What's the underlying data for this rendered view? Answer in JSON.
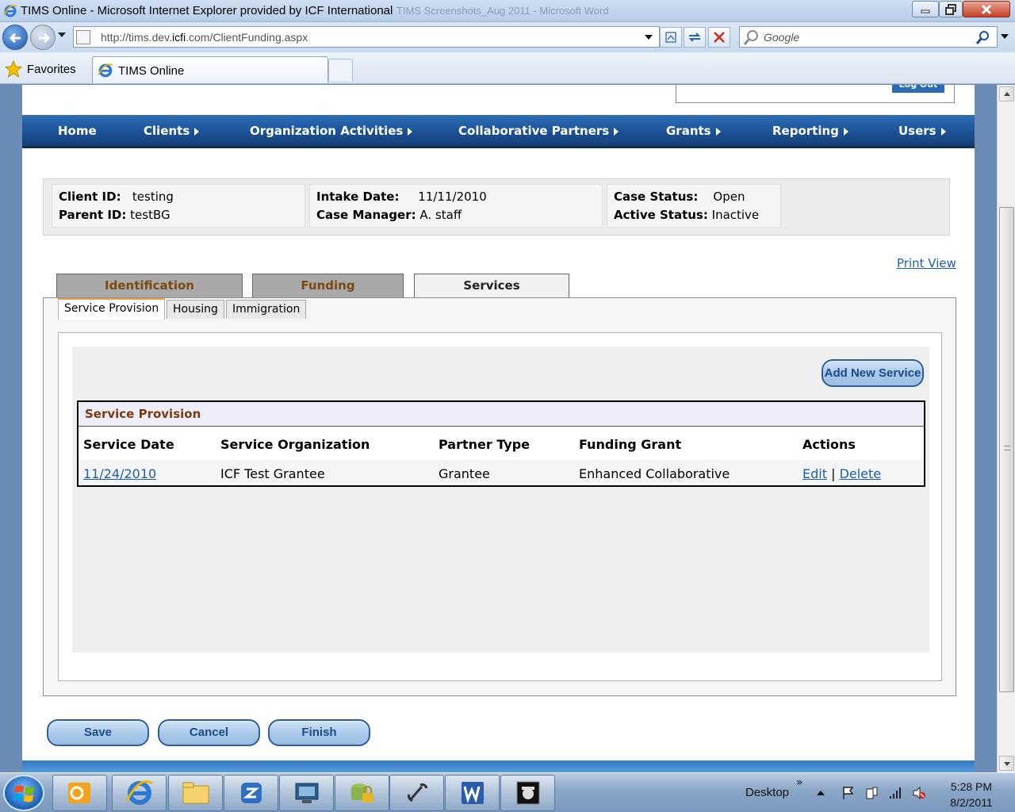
{
  "window": {
    "title": "TIMS Online - Microsoft Internet Explorer provided by ICF International",
    "ghost_title": "TIMS Screenshots_Aug 2011 - Microsoft Word"
  },
  "addressbar": {
    "url_prefix": "http://tims.dev.",
    "url_domain": "icfi",
    "url_suffix": ".com/ClientFunding.aspx",
    "search_placeholder": "Google"
  },
  "favbar": {
    "favorites_label": "Favorites",
    "tab_title": "TIMS Online"
  },
  "header": {
    "logout_label": "Log Out"
  },
  "nav": {
    "items": [
      {
        "label": "Home",
        "has_arrow": false
      },
      {
        "label": "Clients",
        "has_arrow": true
      },
      {
        "label": "Organization Activities",
        "has_arrow": true
      },
      {
        "label": "Collaborative Partners",
        "has_arrow": true
      },
      {
        "label": "Grants",
        "has_arrow": true
      },
      {
        "label": "Reporting",
        "has_arrow": true
      },
      {
        "label": "Users",
        "has_arrow": true
      }
    ]
  },
  "client": {
    "client_id_label": "Client ID:",
    "client_id": "testing",
    "parent_id_label": "Parent ID:",
    "parent_id": "testBG",
    "intake_date_label": "Intake Date:",
    "intake_date": "11/11/2010",
    "case_manager_label": "Case Manager:",
    "case_manager": "A. staff",
    "case_status_label": "Case Status:",
    "case_status": "Open",
    "active_status_label": "Active Status:",
    "active_status": "Inactive"
  },
  "print_view_label": "Print View",
  "tabs": [
    "Identification",
    "Funding",
    "Services"
  ],
  "subtabs": [
    "Service Provision",
    "Housing",
    "Immigration"
  ],
  "add_service_label": "Add New Service",
  "service_table": {
    "caption": "Service Provision",
    "headers": [
      "Service Date",
      "Service Organization",
      "Partner Type",
      "Funding Grant",
      "Actions"
    ],
    "rows": [
      {
        "date": "11/24/2010",
        "organization": "ICF Test Grantee",
        "partner_type": "Grantee",
        "funding_grant": "Enhanced Collaborative",
        "edit": "Edit",
        "sep": "|",
        "delete": "Delete"
      }
    ]
  },
  "buttons": {
    "save": "Save",
    "cancel": "Cancel",
    "finish": "Finish"
  },
  "taskbar": {
    "desktop_label": "Desktop",
    "chevron": "»",
    "time": "5:28 PM",
    "date": "8/2/2011"
  },
  "colors": {
    "nav_blue": "#1b4f91",
    "link_blue": "#1a5fb4",
    "tab_text_brown": "#7a4a10",
    "caption_brown": "#7a3b10",
    "subtab_accent": "#e8a33a"
  }
}
